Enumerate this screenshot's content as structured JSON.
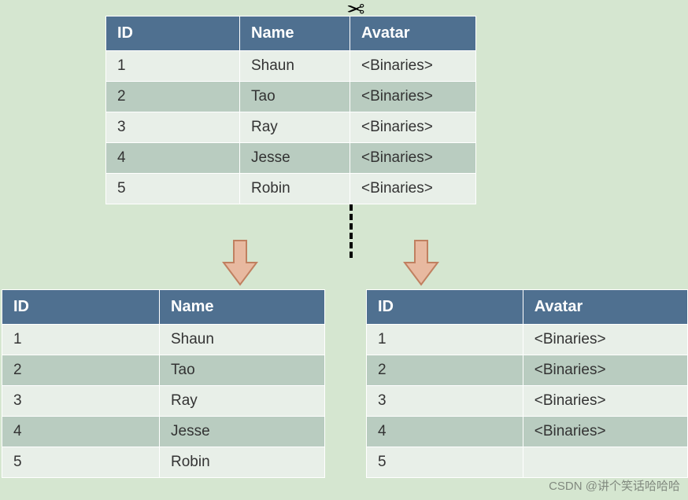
{
  "top_table": {
    "headers": [
      "ID",
      "Name",
      "Avatar"
    ],
    "rows": [
      [
        "1",
        "Shaun",
        "<Binaries>"
      ],
      [
        "2",
        "Tao",
        "<Binaries>"
      ],
      [
        "3",
        "Ray",
        "<Binaries>"
      ],
      [
        "4",
        "Jesse",
        "<Binaries>"
      ],
      [
        "5",
        "Robin",
        "<Binaries>"
      ]
    ]
  },
  "left_table": {
    "headers": [
      "ID",
      "Name"
    ],
    "rows": [
      [
        "1",
        "Shaun"
      ],
      [
        "2",
        "Tao"
      ],
      [
        "3",
        "Ray"
      ],
      [
        "4",
        "Jesse"
      ],
      [
        "5",
        "Robin"
      ]
    ]
  },
  "right_table": {
    "headers": [
      "ID",
      "Avatar"
    ],
    "rows": [
      [
        "1",
        "<Binaries>"
      ],
      [
        "2",
        "<Binaries>"
      ],
      [
        "3",
        "<Binaries>"
      ],
      [
        "4",
        "<Binaries>"
      ],
      [
        "5",
        ""
      ]
    ]
  },
  "watermark": "CSDN @讲个笑话哈哈哈"
}
